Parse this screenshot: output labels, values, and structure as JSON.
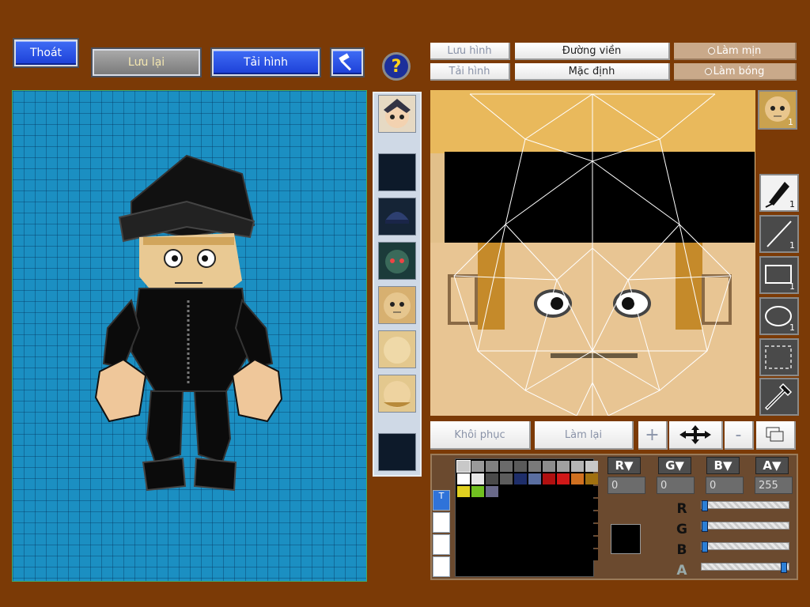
{
  "top_buttons": {
    "exit": "Thoát",
    "save": "Lưu lại",
    "load": "Tải hình",
    "help": "?"
  },
  "editor_toolbar": {
    "save_image": "Lưu hình",
    "load_image": "Tải hình",
    "outline": "Đường viền",
    "default": "Mặc định",
    "smooth": "Làm mịn",
    "shade": "Làm bóng"
  },
  "bottom_bar": {
    "restore": "Khôi phục",
    "redo": "Làm lại",
    "zoom_in": "+",
    "zoom_out": "-"
  },
  "tools": {
    "pen": {
      "icon": "pen-icon",
      "count": "1"
    },
    "line": {
      "icon": "line-icon",
      "count": "1"
    },
    "rect": {
      "icon": "rectangle-icon",
      "count": "1"
    },
    "ellipse": {
      "icon": "ellipse-icon",
      "count": "1"
    },
    "select": {
      "icon": "selection-icon"
    },
    "picker": {
      "icon": "eyedropper-icon"
    }
  },
  "face_preview_badge": "1",
  "color": {
    "r": "0",
    "g": "0",
    "b": "0",
    "a": "255",
    "current": "#000000",
    "r_level": 0,
    "g_level": 0,
    "b_level": 0,
    "a_level": 1.0
  },
  "swatches": [
    "#c8c8c8",
    "#9a9a9a",
    "#808080",
    "#6a6a6a",
    "#5a5a5a",
    "#7a7a7a",
    "#8c8c8c",
    "#a0a0a0",
    "#b4b4b4",
    "#c8c8c8",
    "#ffffff",
    "#e6e6e6",
    "#4a4a4a",
    "#5c5c5c",
    "#1e2e6a",
    "#5a6ea0",
    "#b01010",
    "#d01818",
    "#d07020",
    "#a07010",
    "#e0d020",
    "#70c020",
    "#6a6a8a"
  ],
  "channel_labels": {
    "r": "R",
    "g": "G",
    "b": "B",
    "a": "A"
  }
}
